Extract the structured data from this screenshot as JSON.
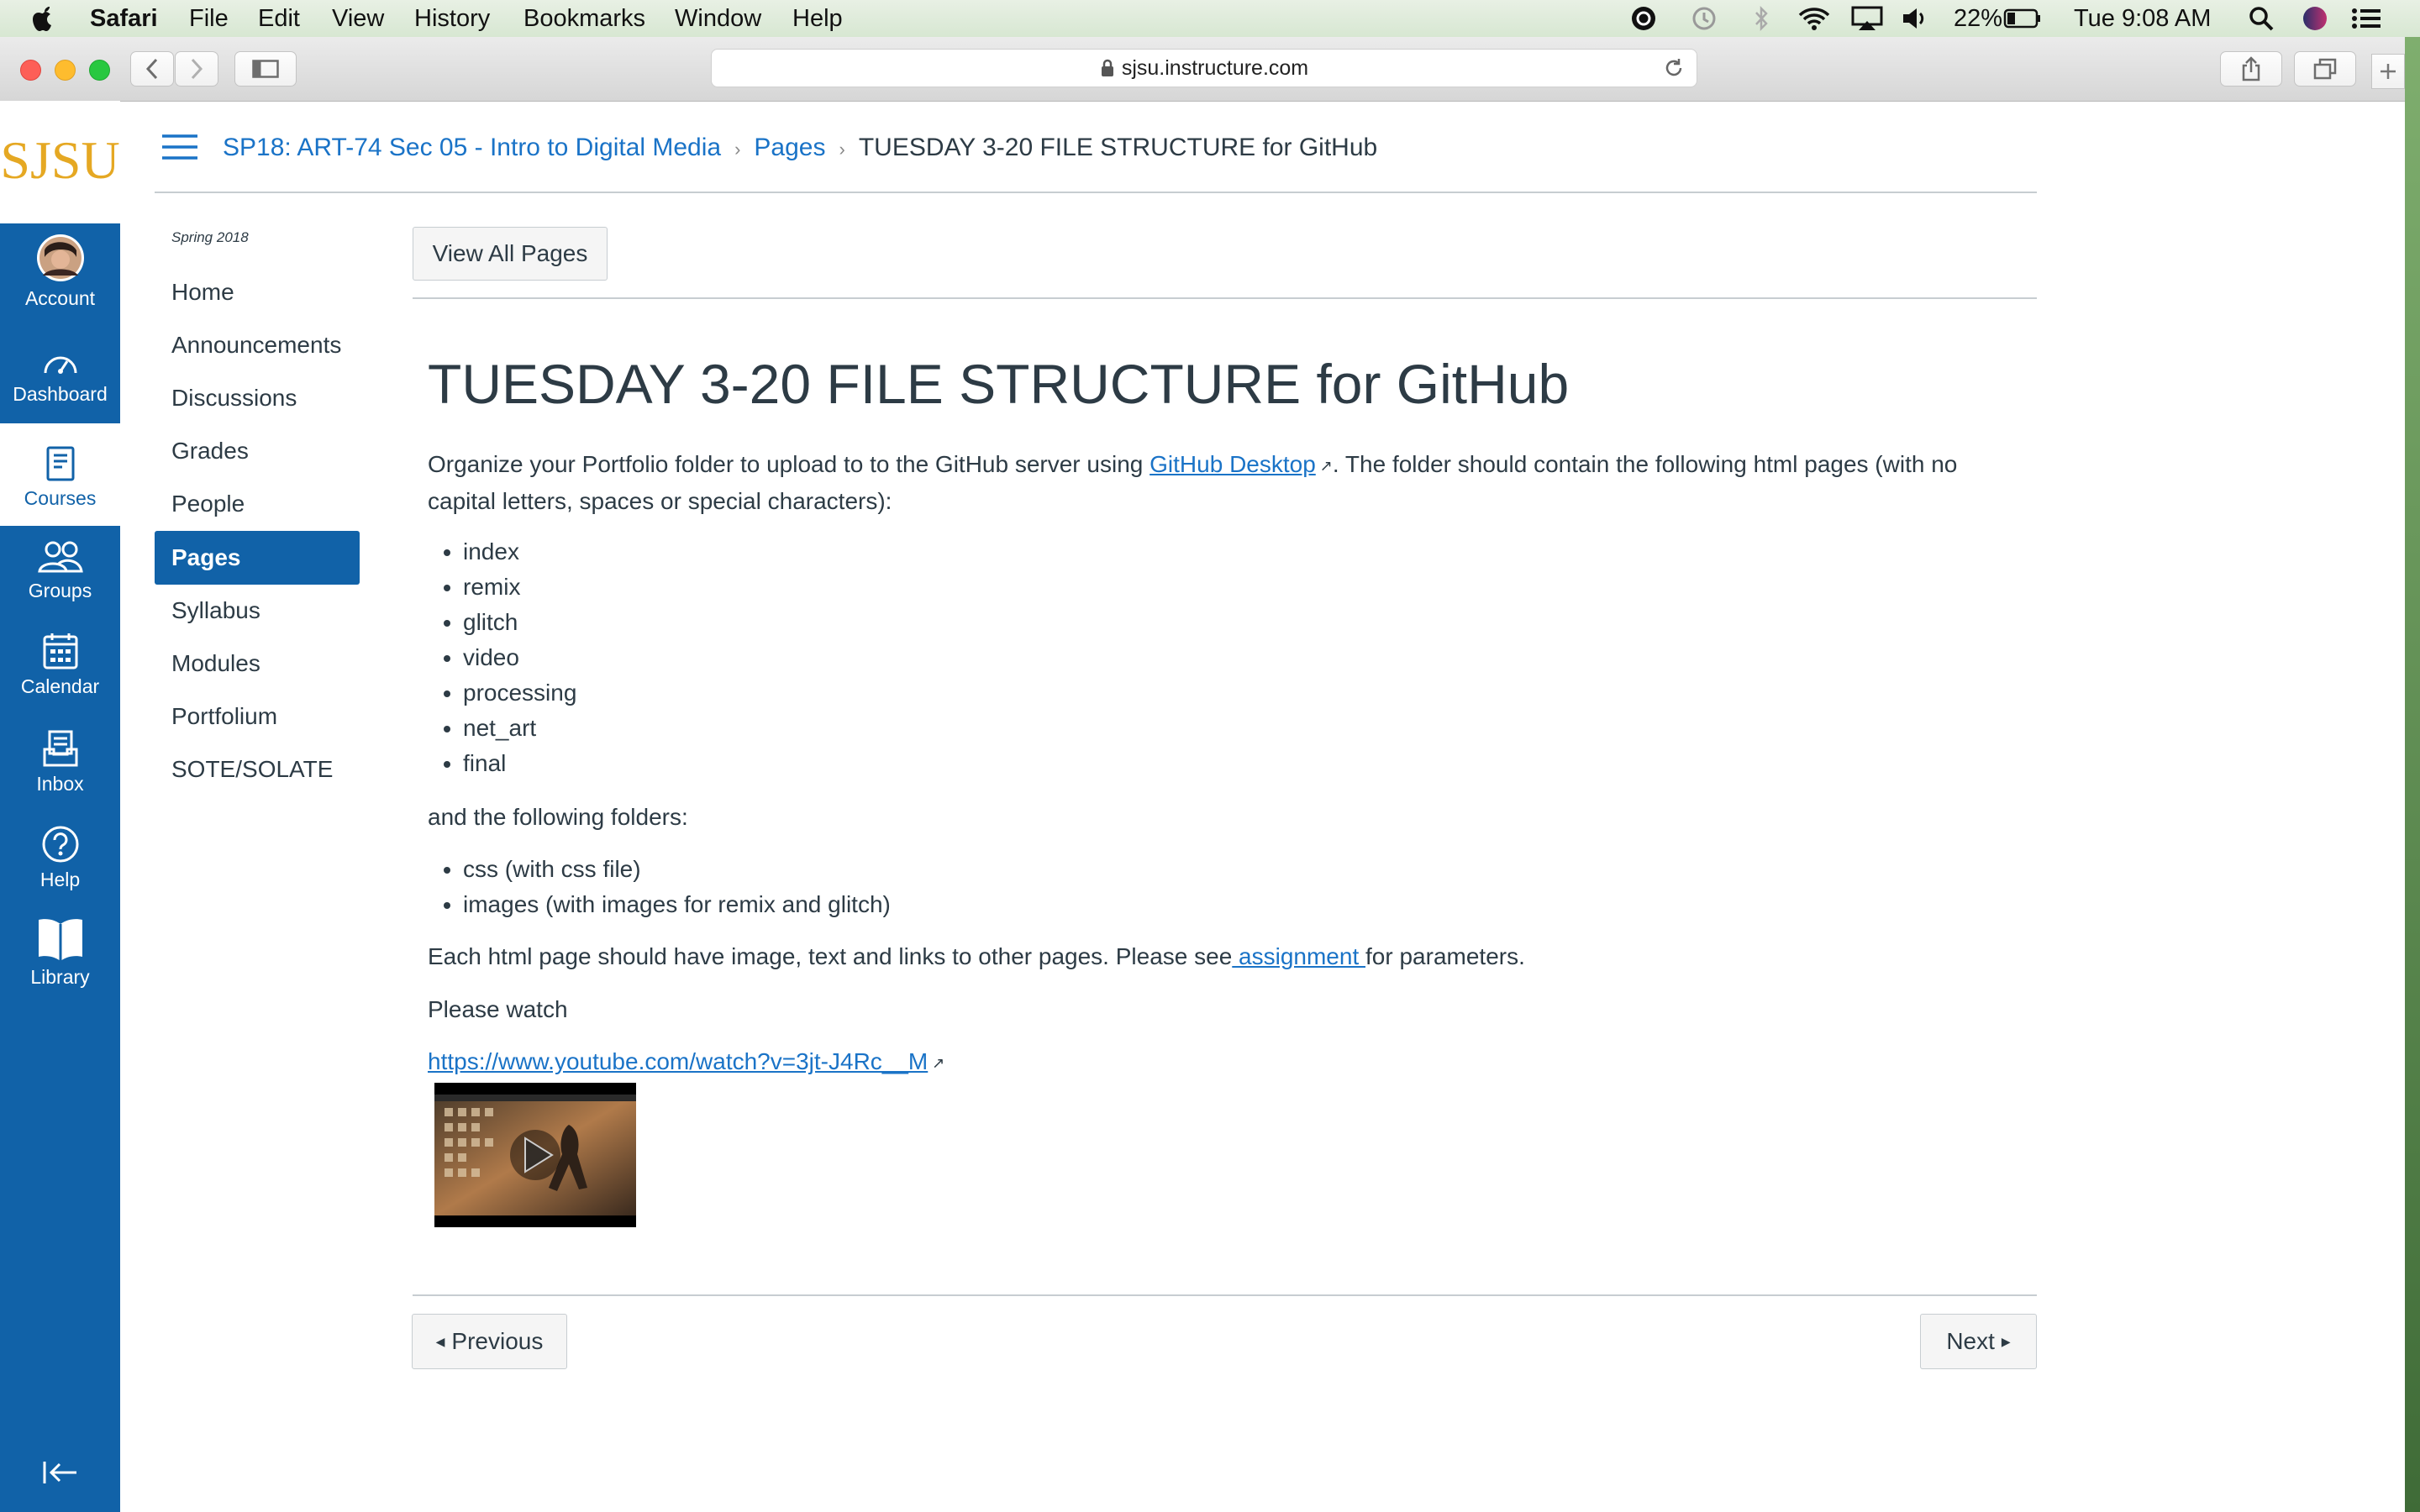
{
  "menubar": {
    "app": "Safari",
    "items": [
      "File",
      "Edit",
      "View",
      "History",
      "Bookmarks",
      "Window",
      "Help"
    ],
    "battery": "22%",
    "clock": "Tue 9:08 AM"
  },
  "browser": {
    "url": "sjsu.instructure.com"
  },
  "brand": {
    "logo_text": "SJSU",
    "logo_color": "#e5a823",
    "nav_color": "#1162a8",
    "link_color": "#1a73c7"
  },
  "global_nav": [
    {
      "label": "Account",
      "icon": "avatar"
    },
    {
      "label": "Dashboard",
      "icon": "dashboard-icon"
    },
    {
      "label": "Courses",
      "icon": "courses-icon"
    },
    {
      "label": "Groups",
      "icon": "groups-icon"
    },
    {
      "label": "Calendar",
      "icon": "calendar-icon"
    },
    {
      "label": "Inbox",
      "icon": "inbox-icon"
    },
    {
      "label": "Help",
      "icon": "help-icon"
    },
    {
      "label": "Library",
      "icon": "library-icon"
    }
  ],
  "breadcrumb": {
    "course": "SP18: ART-74 Sec 05 - Intro to Digital Media",
    "section": "Pages",
    "current": "TUESDAY 3-20 FILE STRUCTURE for GitHub"
  },
  "course_nav": {
    "term": "Spring 2018",
    "items": [
      "Home",
      "Announcements",
      "Discussions",
      "Grades",
      "People",
      "Pages",
      "Syllabus",
      "Modules",
      "Portfolium",
      "SOTE/SOLATE"
    ],
    "active": "Pages"
  },
  "page": {
    "view_all_label": "View All Pages",
    "title": "TUESDAY 3-20 FILE STRUCTURE for GitHub",
    "intro_before": "Organize your Portfolio folder to upload to to the GitHub server using ",
    "intro_link": "GitHub Desktop",
    "intro_after": ". The folder should contain the following html pages (with no capital letters, spaces or special characters):",
    "pages_list": [
      "index",
      "remix",
      "glitch",
      "video",
      "processing",
      "net_art",
      "final"
    ],
    "folders_intro": "and the following folders:",
    "folders_list": [
      "css (with css file)",
      "images (with images for remix and glitch)"
    ],
    "each_before": "Each html page should have image, text and links to other pages. Please see",
    "each_link": " assignment ",
    "each_after": "for parameters.",
    "watch_text": "Please watch",
    "video_link": "https://www.youtube.com/watch?v=3jt-J4Rc__M"
  },
  "pagination": {
    "previous": "Previous",
    "next": "Next"
  }
}
